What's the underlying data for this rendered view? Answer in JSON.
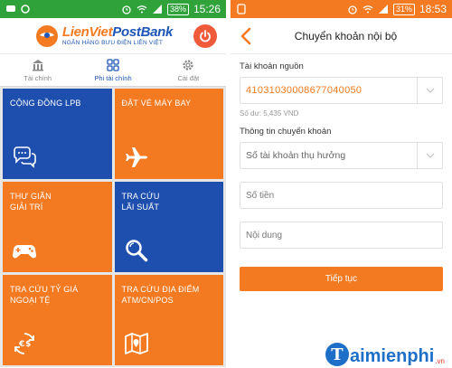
{
  "left": {
    "status": {
      "battery": "38%",
      "time": "15:26"
    },
    "logo": {
      "brand_a": "LienViet",
      "brand_b": "PostBank",
      "tagline": "NGÂN HÀNG BƯU ĐIỆN LIÊN VIỆT"
    },
    "tabs": [
      {
        "label": "Tài chính",
        "icon": "bank-icon"
      },
      {
        "label": "Phi tài chính",
        "icon": "grid-icon"
      },
      {
        "label": "Cài đặt",
        "icon": "gear-icon"
      }
    ],
    "tiles": [
      {
        "label": "CỘNG ĐỒNG LPB",
        "color": "#1f4fae",
        "icon": "chat-bubbles-icon"
      },
      {
        "label": "ĐẶT VÉ MÁY BAY",
        "color": "#f37a20",
        "icon": "airplane-icon"
      },
      {
        "label": "THƯ GIÃN\nGIẢI TRÍ",
        "color": "#f37a20",
        "icon": "gamepad-icon"
      },
      {
        "label": "TRA CỨU\nLÃI SUẤT",
        "color": "#1f4fae",
        "icon": "magnifier-icon"
      },
      {
        "label": "TRA CỨU TỶ GIÁ\nNGOẠI TỆ",
        "color": "#f37a20",
        "icon": "currency-exchange-icon"
      },
      {
        "label": "TRA CỨU ĐỊA ĐIỂM\nATM/CN/POS",
        "color": "#f37a20",
        "icon": "map-icon"
      }
    ]
  },
  "right": {
    "status": {
      "battery": "31%",
      "time": "18:53"
    },
    "title": "Chuyển khoản nội bộ",
    "source_label": "Tài khoản nguồn",
    "source_account": "41031030008677040050",
    "balance": "Số dư: 5,435 VND",
    "transfer_label": "Thông tin chuyển khoản",
    "beneficiary_placeholder": "Số tài khoản thụ hưởng",
    "amount_placeholder": "Số tiền",
    "content_placeholder": "Nội dung",
    "continue_label": "Tiếp tục"
  },
  "watermark": {
    "mark": "T",
    "text": "aimienphi",
    "ext": ".vn"
  },
  "colors": {
    "orange": "#f37a20",
    "blue": "#1f4fae",
    "status_green": "#2fa23a"
  }
}
